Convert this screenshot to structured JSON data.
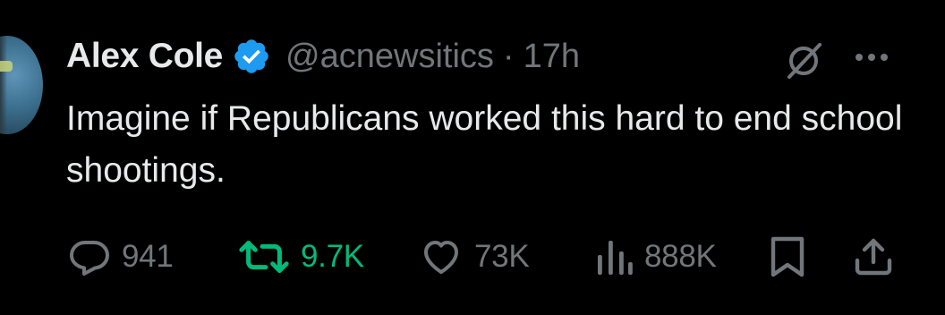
{
  "author": {
    "name": "Alex Cole",
    "handle": "@acnewsitics",
    "separator": "·",
    "time": "17h",
    "verified": true
  },
  "tweet": {
    "text": "Imagine if Republicans worked this hard to end school shootings."
  },
  "actions": {
    "replies": "941",
    "retweets": "9.7K",
    "likes": "73K",
    "views": "888K"
  },
  "colors": {
    "background": "#000000",
    "text": "#e7e9ea",
    "muted": "#71767b",
    "verified_badge": "#1d9bf0",
    "retweet_active": "#00ba7c"
  },
  "icons": {
    "reply": "speech-bubble-icon",
    "retweet": "retweet-icon",
    "like": "heart-icon",
    "views": "bar-chart-icon",
    "bookmark": "bookmark-icon",
    "share": "share-icon",
    "grok": "grok-icon",
    "more": "ellipsis-icon"
  }
}
